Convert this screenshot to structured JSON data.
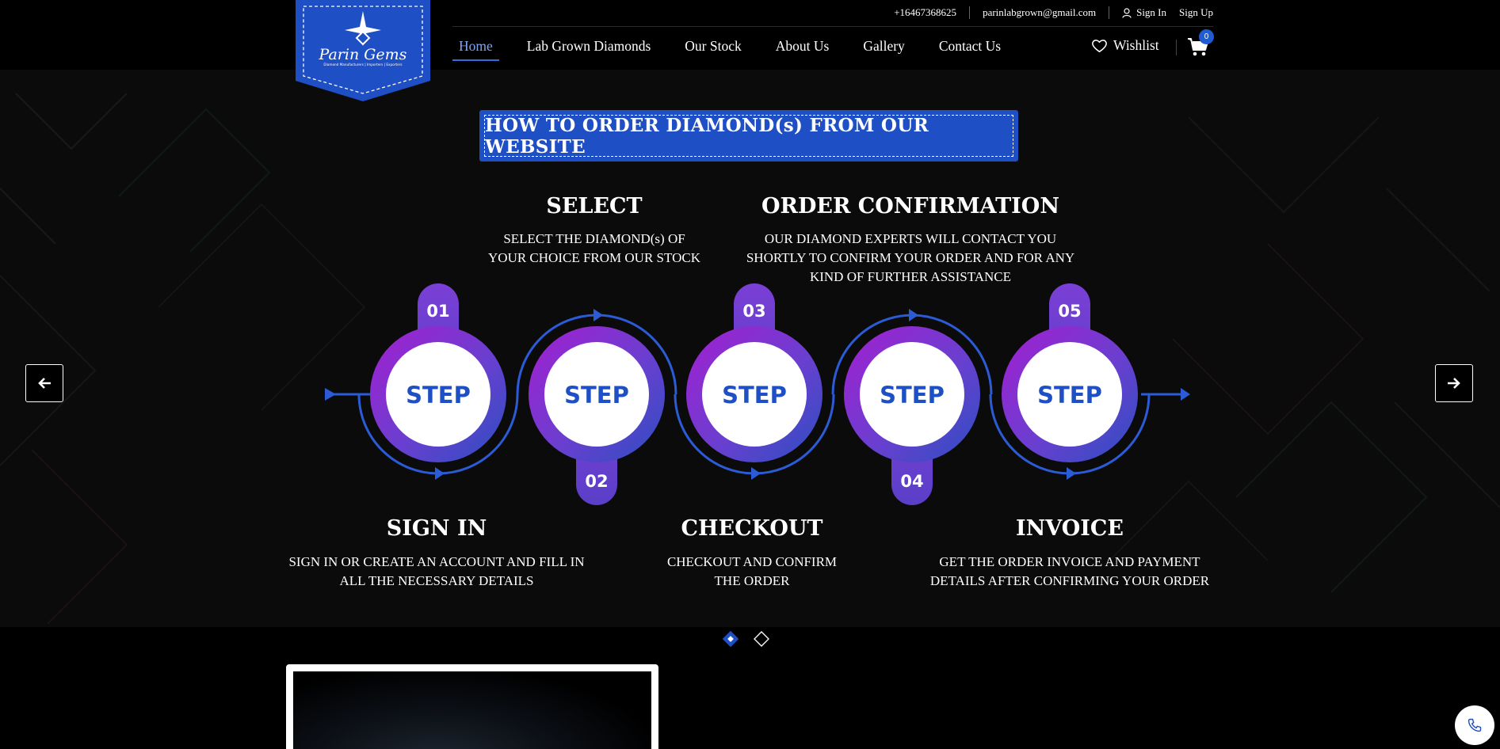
{
  "header": {
    "brand": "Parin Gems",
    "brand_tagline": "Diamond Manufacturers | Importers | Exporters",
    "phone": "+16467368625",
    "email": "parinlabgrown@gmail.com",
    "sign_in": "Sign In",
    "sign_up": "Sign Up",
    "nav": [
      {
        "label": "Home",
        "active": true
      },
      {
        "label": "Lab Grown Diamonds"
      },
      {
        "label": "Our Stock"
      },
      {
        "label": "About Us"
      },
      {
        "label": "Gallery"
      },
      {
        "label": "Contact Us"
      }
    ],
    "wishlist": "Wishlist",
    "cart_count": "0"
  },
  "hero": {
    "title": "HOW TO ORDER DIAMOND(s) FROM OUR WEBSITE",
    "step_word": "STEP",
    "steps": [
      {
        "number": "01",
        "title": "SIGN IN",
        "desc": [
          "SIGN IN OR CREATE AN ACCOUNT AND FILL IN",
          "ALL THE NECESSARY DETAILS"
        ]
      },
      {
        "number": "02",
        "title": "SELECT",
        "desc": [
          "SELECT THE DIAMOND(s) OF",
          "YOUR CHOICE FROM OUR STOCK"
        ]
      },
      {
        "number": "03",
        "title": "CHECKOUT",
        "desc": [
          "CHECKOUT AND CONFIRM",
          "THE ORDER"
        ]
      },
      {
        "number": "04",
        "title": "ORDER CONFIRMATION",
        "desc": [
          "OUR DIAMOND EXPERTS WILL CONTACT YOU",
          "SHORTLY TO CONFIRM YOUR ORDER AND FOR ANY",
          "KIND OF FURTHER ASSISTANCE"
        ]
      },
      {
        "number": "05",
        "title": "INVOICE",
        "desc": [
          "GET THE ORDER INVOICE AND PAYMENT",
          "DETAILS AFTER CONFIRMING YOUR ORDER"
        ]
      }
    ],
    "slides": {
      "count": 2,
      "active": 0
    }
  },
  "colors": {
    "accent_blue": "#1f4fc4",
    "purple": "#7b3fd6",
    "magenta": "#a41fd0",
    "bg": "#0b0b0c"
  }
}
